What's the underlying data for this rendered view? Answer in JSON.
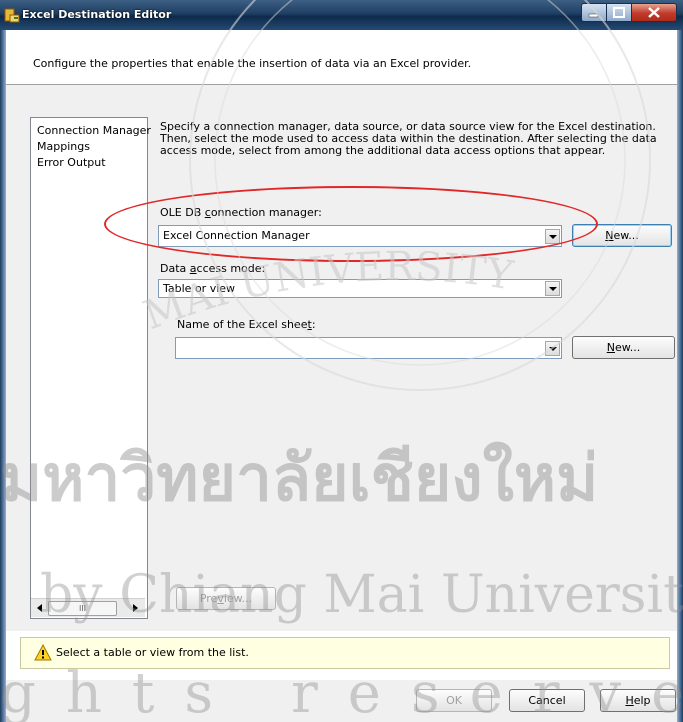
{
  "window": {
    "title": "Excel Destination Editor"
  },
  "header": {
    "text": "Configure the properties that enable the insertion of data via an Excel provider."
  },
  "nav": {
    "items": [
      "Connection Manager",
      "Mappings",
      "Error Output"
    ],
    "scroll_thumb": "III"
  },
  "description": "Specify a connection manager, data source, or data source view for the Excel destination. Then, select the mode used to access data within the destination. After selecting the data access mode, select from among the additional data access options that appear.",
  "connection": {
    "label": "OLE DB connection manager:",
    "label_accel_pre": "OLE DB ",
    "label_accel_char": "c",
    "label_accel_post": "onnection manager:",
    "value": "Excel Connection Manager",
    "new_button_pre": "",
    "new_button_accel": "N",
    "new_button_post": "ew..."
  },
  "access_mode": {
    "label_pre": "Data ",
    "label_accel": "a",
    "label_post": "ccess mode:",
    "value": "Table or view"
  },
  "sheet": {
    "label_pre": "Name of the Excel shee",
    "label_accel": "t",
    "label_post": ":",
    "value": "",
    "new_button_accel": "N",
    "new_button_post": "ew..."
  },
  "preview_button": {
    "pre": "Pre",
    "accel": "v",
    "post": "iew..."
  },
  "status": {
    "text": "Select a table or view from the list."
  },
  "footer": {
    "ok": "OK",
    "cancel": "Cancel",
    "help_accel": "H",
    "help_post": "elp"
  },
  "colors": {
    "highlight": "#e12727",
    "status_bg": "#ffffe1",
    "titlebar": "#1f3f63"
  },
  "watermark": {
    "thai": "มหาวิทยาลัยเชียงใหม่",
    "line1": "by Chiang Mai University",
    "line2": "ghts reserved",
    "arc": "MAI UNIVERSITY"
  }
}
